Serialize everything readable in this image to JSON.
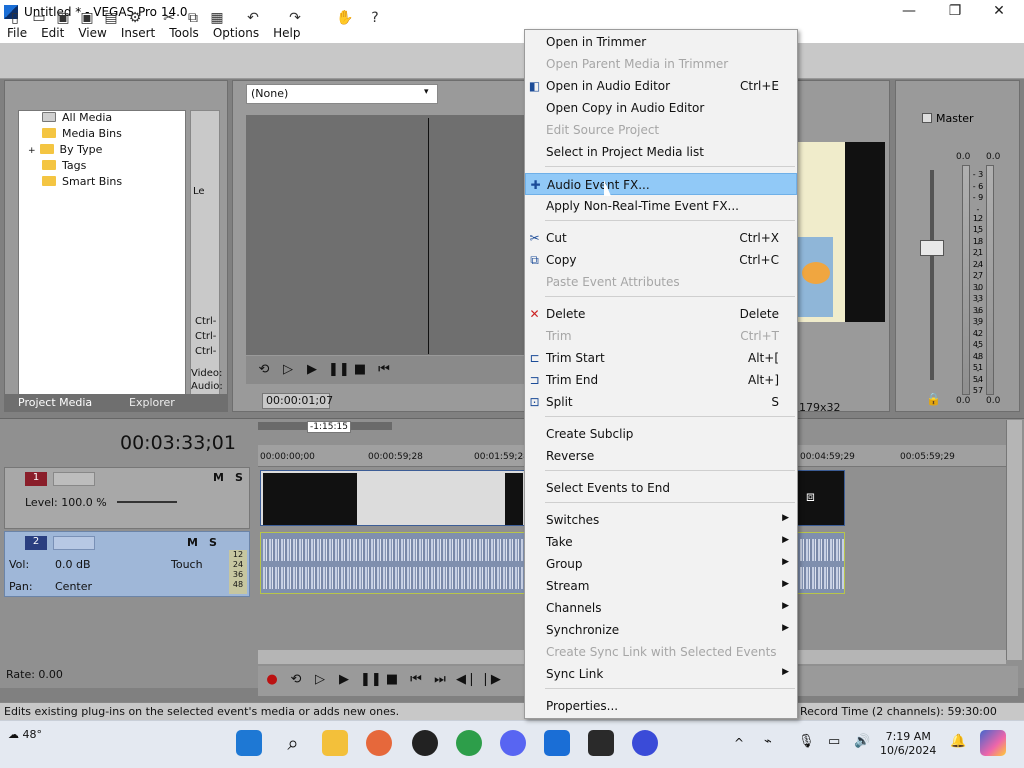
{
  "window": {
    "title": "Untitled * - VEGAS Pro 14.0",
    "minimize": "—",
    "maximize": "❐",
    "close": "✕"
  },
  "menubar": [
    "File",
    "Edit",
    "View",
    "Insert",
    "Tools",
    "Options",
    "Help"
  ],
  "project_media": {
    "tree": [
      "All Media",
      "Media Bins",
      "By Type",
      "Tags",
      "Smart Bins"
    ],
    "tabs": [
      "Project Media",
      "Explorer"
    ],
    "side_snippets": [
      "Le",
      "Ctrl-",
      "Ctrl-",
      "Ctrl-",
      "Video:",
      "Audio:"
    ]
  },
  "preview": {
    "dropdown": "(None)",
    "timecode": "00:00:01;07"
  },
  "video_preview": {
    "size": "179x32"
  },
  "master": {
    "label": "Master",
    "scale_top": [
      "0.0",
      "0.0"
    ],
    "scale_bottom": [
      "0.0",
      "0.0"
    ],
    "scale": [
      "3",
      "6",
      "9",
      "12",
      "15",
      "18",
      "21",
      "24",
      "27",
      "30",
      "33",
      "36",
      "39",
      "42",
      "45",
      "48",
      "51",
      "54",
      "57"
    ]
  },
  "timeline": {
    "time": "00:03:33;01",
    "loop_label": "-1:15:15",
    "ruler": [
      "00:00:00;00",
      "00:00:59;28",
      "00:01:59;28",
      "00:04:59;29",
      "00:05:59;29"
    ],
    "track1": {
      "num": "1",
      "level": "Level: 100.0 %"
    },
    "track2": {
      "num": "2",
      "vol": "Vol:",
      "vol_val": "0.0 dB",
      "pan": "Pan:",
      "pan_val": "Center",
      "touch": "Touch",
      "meter": [
        "12",
        "24",
        "36",
        "48"
      ]
    },
    "rate": "Rate: 0.00"
  },
  "status": {
    "text": "Edits existing plug-ins on the selected event's media or adds new ones.",
    "record": "Record Time (2 channels): 59:30:00"
  },
  "taskbar": {
    "weather": "48°",
    "time": "7:19 AM",
    "date": "10/6/2024"
  },
  "context_menu": [
    {
      "label": "Open in Trimmer",
      "shortcut": "",
      "disabled": false
    },
    {
      "label": "Open Parent Media in Trimmer",
      "shortcut": "",
      "disabled": true
    },
    {
      "label": "Open in Audio Editor",
      "shortcut": "Ctrl+E",
      "disabled": false,
      "icon": "audio-editor-icon"
    },
    {
      "label": "Open Copy in Audio Editor",
      "shortcut": "",
      "disabled": false
    },
    {
      "label": "Edit Source Project",
      "shortcut": "",
      "disabled": true
    },
    {
      "label": "Select in Project Media list",
      "shortcut": "",
      "disabled": false
    },
    {
      "label": "Audio Event FX...",
      "shortcut": "",
      "disabled": false,
      "highlight": true,
      "icon": "fx-plug-icon"
    },
    {
      "label": "Apply Non-Real-Time Event FX...",
      "shortcut": "",
      "disabled": false
    },
    {
      "label": "Cut",
      "shortcut": "Ctrl+X",
      "disabled": false,
      "icon": "scissors-icon"
    },
    {
      "label": "Copy",
      "shortcut": "Ctrl+C",
      "disabled": false,
      "icon": "copy-icon"
    },
    {
      "label": "Paste Event Attributes",
      "shortcut": "",
      "disabled": true
    },
    {
      "label": "Delete",
      "shortcut": "Delete",
      "disabled": false,
      "icon": "delete-x-icon"
    },
    {
      "label": "Trim",
      "shortcut": "Ctrl+T",
      "disabled": true
    },
    {
      "label": "Trim Start",
      "shortcut": "Alt+[",
      "disabled": false,
      "icon": "trim-start-icon"
    },
    {
      "label": "Trim End",
      "shortcut": "Alt+]",
      "disabled": false,
      "icon": "trim-end-icon"
    },
    {
      "label": "Split",
      "shortcut": "S",
      "disabled": false,
      "icon": "split-icon"
    },
    {
      "label": "Create Subclip",
      "shortcut": "",
      "disabled": false
    },
    {
      "label": "Reverse",
      "shortcut": "",
      "disabled": false
    },
    {
      "label": "Select Events to End",
      "shortcut": "",
      "disabled": false
    },
    {
      "label": "Switches",
      "shortcut": "",
      "disabled": false,
      "submenu": true
    },
    {
      "label": "Take",
      "shortcut": "",
      "disabled": false,
      "submenu": true
    },
    {
      "label": "Group",
      "shortcut": "",
      "disabled": false,
      "submenu": true
    },
    {
      "label": "Stream",
      "shortcut": "",
      "disabled": false,
      "submenu": true
    },
    {
      "label": "Channels",
      "shortcut": "",
      "disabled": false,
      "submenu": true
    },
    {
      "label": "Synchronize",
      "shortcut": "",
      "disabled": false,
      "submenu": true
    },
    {
      "label": "Create Sync Link with Selected Events",
      "shortcut": "",
      "disabled": true
    },
    {
      "label": "Sync Link",
      "shortcut": "",
      "disabled": false,
      "submenu": true
    },
    {
      "label": "Properties...",
      "shortcut": "",
      "disabled": false
    }
  ]
}
